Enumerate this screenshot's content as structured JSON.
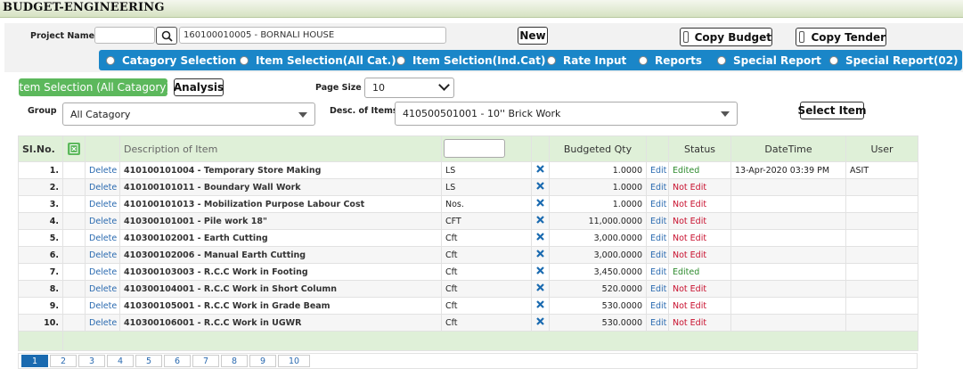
{
  "app": {
    "title": "BUDGET-ENGINEERING"
  },
  "project": {
    "label": "Project Name:",
    "code": "",
    "value": "160100010005 - BORNALI HOUSE",
    "new_label": "New",
    "copy_budget": "Copy Budget",
    "copy_tender": "Copy Tender"
  },
  "tabs": [
    {
      "label": "Catagory Selection",
      "selected": false
    },
    {
      "label": "Item Selection(All Cat.)",
      "selected": true
    },
    {
      "label": "Item Selction(Ind.Cat)",
      "selected": false
    },
    {
      "label": "Rate Input",
      "selected": false
    },
    {
      "label": "Reports",
      "selected": false
    },
    {
      "label": "Special Report",
      "selected": false
    },
    {
      "label": "Special Report(02)",
      "selected": false
    }
  ],
  "toolbar": {
    "item_selection": "Item Selection (All Catagory)",
    "analysis": "Analysis",
    "page_size_label": "Page Size",
    "page_size": "10",
    "group_label": "Group",
    "group_value": "All Catagory",
    "desc_label": "Desc. of Items",
    "desc_value": "410500501001 - 10'' Brick Work",
    "select_item": "Select Item"
  },
  "grid": {
    "headers": {
      "sl": "Sl.No.",
      "desc": "Description of Item",
      "qty": "Budgeted Qty",
      "status": "Status",
      "datetime": "DateTime",
      "user": "User"
    },
    "search_placeholder": "",
    "rows": [
      {
        "sl": "1.",
        "action": "Delete",
        "desc": "410100101004 - Temporary Store Making",
        "unit": "LS",
        "qty": "1.0000",
        "edit": "Edit",
        "status": "Edited",
        "datetime": "13-Apr-2020 03:39 PM",
        "user": "ASIT"
      },
      {
        "sl": "2.",
        "action": "Delete",
        "desc": "410100101011 - Boundary Wall Work",
        "unit": "LS",
        "qty": "1.0000",
        "edit": "Edit",
        "status": "Not Edit",
        "datetime": "",
        "user": ""
      },
      {
        "sl": "3.",
        "action": "Delete",
        "desc": "410100101013 - Mobilization Purpose Labour Cost",
        "unit": "Nos.",
        "qty": "1.0000",
        "edit": "Edit",
        "status": "Not Edit",
        "datetime": "",
        "user": ""
      },
      {
        "sl": "4.",
        "action": "Delete",
        "desc": "410300101001 - Pile work 18\"",
        "unit": "CFT",
        "qty": "11,000.0000",
        "edit": "Edit",
        "status": "Not Edit",
        "datetime": "",
        "user": ""
      },
      {
        "sl": "5.",
        "action": "Delete",
        "desc": "410300102001 - Earth Cutting",
        "unit": "Cft",
        "qty": "3,000.0000",
        "edit": "Edit",
        "status": "Not Edit",
        "datetime": "",
        "user": ""
      },
      {
        "sl": "6.",
        "action": "Delete",
        "desc": "410300102006 - Manual Earth Cutting",
        "unit": "Cft",
        "qty": "3,000.0000",
        "edit": "Edit",
        "status": "Not Edit",
        "datetime": "",
        "user": ""
      },
      {
        "sl": "7.",
        "action": "Delete",
        "desc": "410300103003 - R.C.C Work in Footing",
        "unit": "Cft",
        "qty": "3,450.0000",
        "edit": "Edit",
        "status": "Edited",
        "datetime": "",
        "user": ""
      },
      {
        "sl": "8.",
        "action": "Delete",
        "desc": "410300104001 - R.C.C Work in Short Column",
        "unit": "Cft",
        "qty": "520.0000",
        "edit": "Edit",
        "status": "Not Edit",
        "datetime": "",
        "user": ""
      },
      {
        "sl": "9.",
        "action": "Delete",
        "desc": "410300105001 - R.C.C Work in Grade Beam",
        "unit": "Cft",
        "qty": "530.0000",
        "edit": "Edit",
        "status": "Not Edit",
        "datetime": "",
        "user": ""
      },
      {
        "sl": "10.",
        "action": "Delete",
        "desc": "410300106001 - R.C.C Work in UGWR",
        "unit": "Cft",
        "qty": "530.0000",
        "edit": "Edit",
        "status": "Not Edit",
        "datetime": "",
        "user": ""
      }
    ]
  },
  "pager": {
    "pages": [
      "1",
      "2",
      "3",
      "4",
      "5",
      "6",
      "7",
      "8",
      "9",
      "10"
    ],
    "active": "1"
  },
  "icons": {
    "search": "search-icon",
    "excel": "excel-icon",
    "remove": "close-icon",
    "dropdown": "chevron-down-icon"
  },
  "colors": {
    "tab_bar": "#1a86c8",
    "green_button": "#5cb85c",
    "header_bg": "#dff0d8",
    "edited": "#2e8b2e",
    "not_edited": "#c8102e"
  }
}
